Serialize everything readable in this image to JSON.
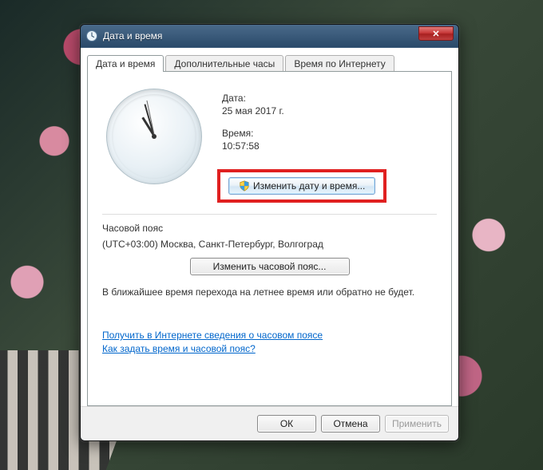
{
  "window": {
    "title": "Дата и время"
  },
  "tabs": [
    {
      "label": "Дата и время",
      "active": true
    },
    {
      "label": "Дополнительные часы",
      "active": false
    },
    {
      "label": "Время по Интернету",
      "active": false
    }
  ],
  "date": {
    "label": "Дата:",
    "value": "25 мая 2017 г."
  },
  "time": {
    "label": "Время:",
    "value": "10:57:58"
  },
  "change_datetime_button": "Изменить дату и время...",
  "timezone": {
    "section_label": "Часовой пояс",
    "value": "(UTC+03:00) Москва, Санкт-Петербург, Волгоград",
    "change_button": "Изменить часовой пояс..."
  },
  "dst_note": "В ближайшее время перехода на летнее время или обратно не будет.",
  "links": {
    "info": "Получить в Интернете сведения о часовом поясе",
    "help": "Как задать время и часовой пояс?"
  },
  "buttons": {
    "ok": "ОК",
    "cancel": "Отмена",
    "apply": "Применить"
  }
}
